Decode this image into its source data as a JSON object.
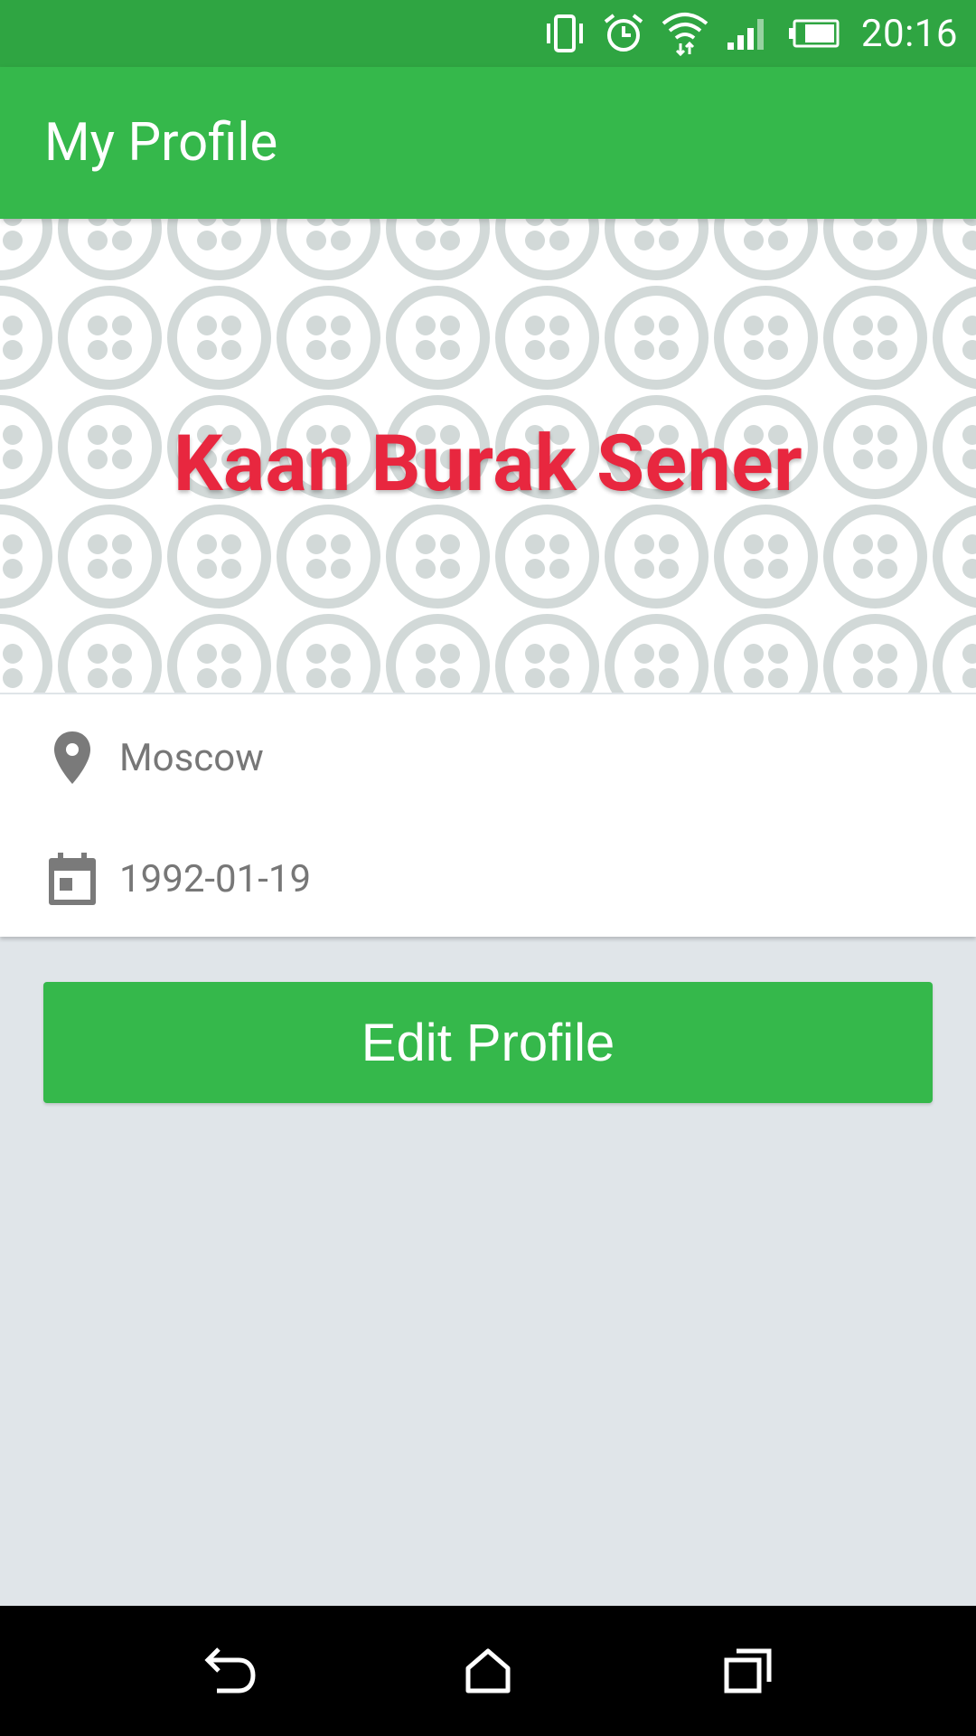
{
  "status_bar": {
    "time": "20:16",
    "icons": [
      "vibrate-icon",
      "alarm-icon",
      "wifi-icon",
      "signal-icon",
      "battery-icon"
    ]
  },
  "app_bar": {
    "title": "My Profile"
  },
  "profile": {
    "name": "Kaan Burak Sener",
    "location": "Moscow",
    "birth_date": "1992-01-19",
    "location_icon": "location-pin-icon",
    "birth_icon": "calendar-icon"
  },
  "actions": {
    "edit_label": "Edit Profile"
  },
  "nav_bar": {
    "icons": [
      "back-icon",
      "home-icon",
      "recents-icon"
    ]
  },
  "colors": {
    "status_bar": "#2fa542",
    "app_bar": "#35b84b",
    "accent_name": "#e8273f",
    "background": "#e0e5e9"
  }
}
